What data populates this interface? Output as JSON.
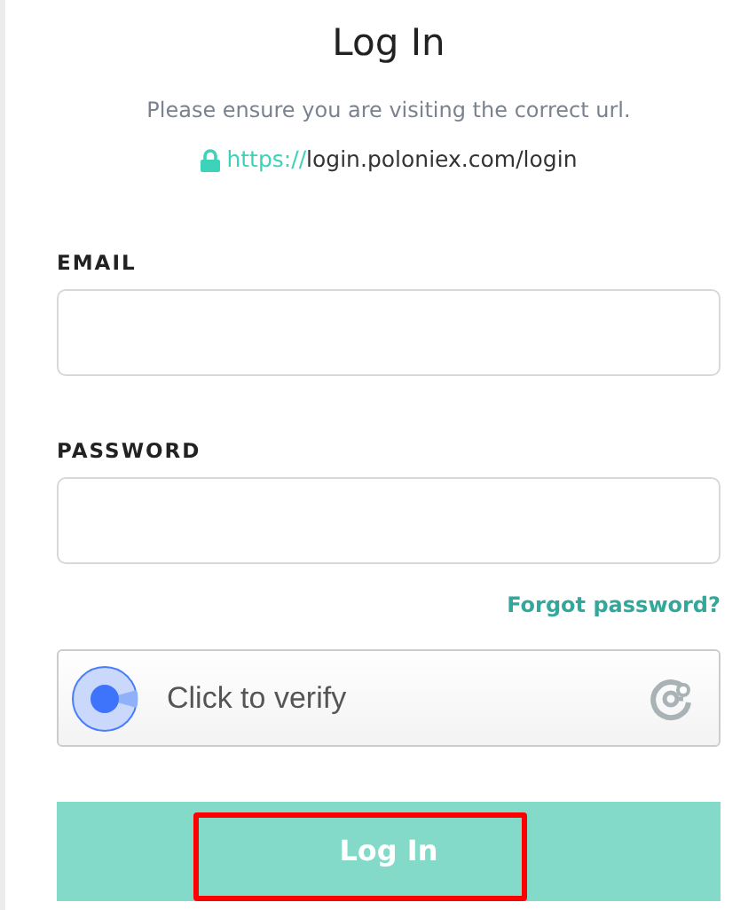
{
  "title": "Log In",
  "notice": "Please ensure you are visiting the correct url.",
  "url": {
    "scheme": "https://",
    "rest": "login.poloniex.com/login"
  },
  "fields": [
    {
      "label": "EMAIL"
    },
    {
      "label": "PASSWORD"
    }
  ],
  "forgot_link": "Forgot password?",
  "captcha": {
    "label": "Click to verify"
  },
  "submit": {
    "label": "Log In",
    "highlighted": true
  }
}
